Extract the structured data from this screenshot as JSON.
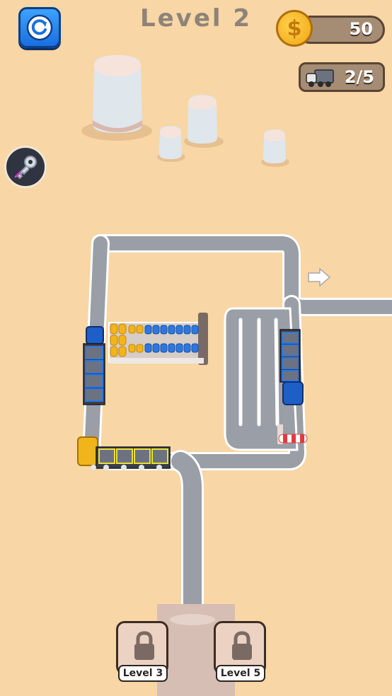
{
  "header": {
    "level_title": "Level 2",
    "restart_icon": "restart-icon",
    "coins": "50",
    "coin_icon": "coin-icon",
    "truck_count": "2/5",
    "truck_icon": "truck-icon"
  },
  "tools": {
    "key_icon": "key-icon"
  },
  "locked_levels": [
    {
      "label": "Level 3"
    },
    {
      "label": "Level 5"
    }
  ],
  "colors": {
    "background": "#f8d6a5",
    "road": "#9a9ea6",
    "road_edge": "#ffffff",
    "blue_cargo": "#2d78de",
    "yellow_cargo": "#f1b51b",
    "button_blue": "#1a6fe0"
  }
}
